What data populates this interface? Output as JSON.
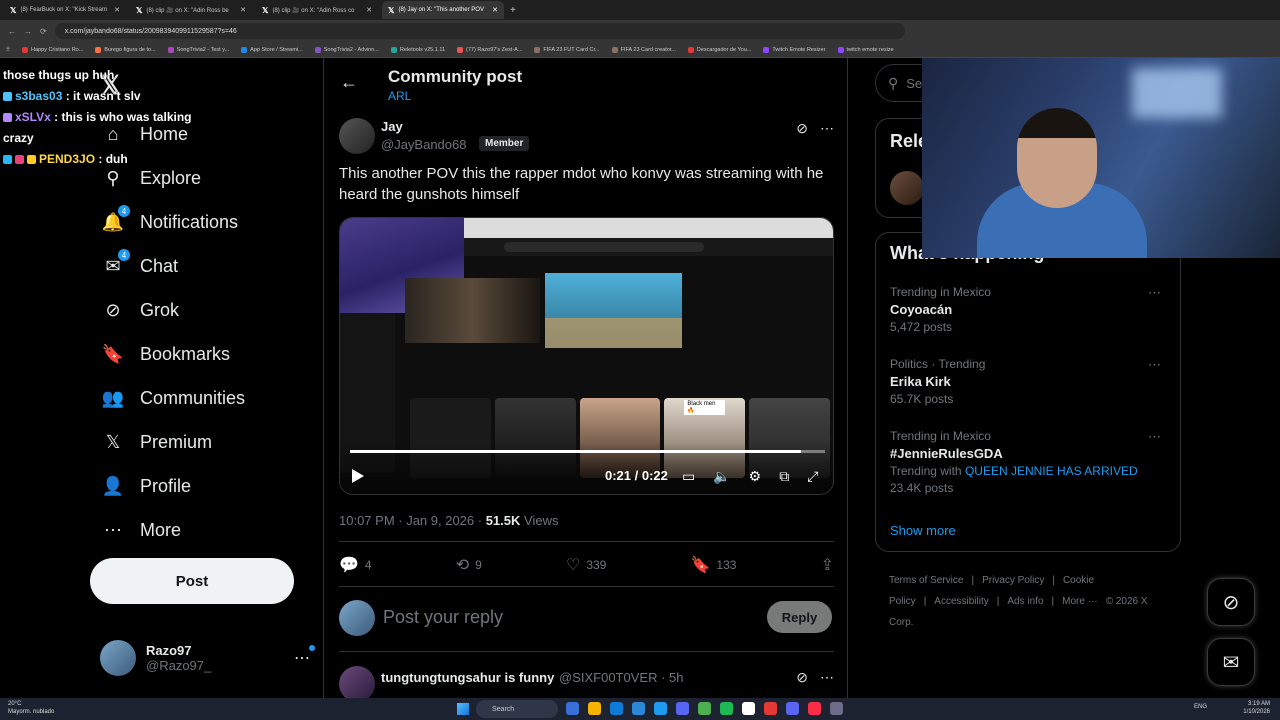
{
  "browser": {
    "tabs": [
      {
        "label": "(8) FearBuck on X: \"Kick Stream",
        "active": false
      },
      {
        "label": "(8) clip 🎥 on X: \"Adin Ross be",
        "active": false
      },
      {
        "label": "(8) clip 🎥 on X: \"Adin Ross co",
        "active": false
      },
      {
        "label": "(8) Jay on X: \"This another POV",
        "active": true
      }
    ],
    "url": "x.com/jaybando68/status/2009839409911529587?s=46",
    "bookmarks": [
      {
        "label": "Happy Cristiano Ro...",
        "color": "#e53935"
      },
      {
        "label": "Burego figura de to...",
        "color": "#ff7043"
      },
      {
        "label": "SongTrivia2 - Test y...",
        "color": "#ab47bc"
      },
      {
        "label": "App Store / Streami...",
        "color": "#1e88e5"
      },
      {
        "label": "SongTrivia2 - Advinn...",
        "color": "#7e57c2"
      },
      {
        "label": "Reletools v25.1.11",
        "color": "#26a69a"
      },
      {
        "label": "(77) Razo97's Zest-A...",
        "color": "#ef5350"
      },
      {
        "label": "FIFA 23 FUT Card Cr...",
        "color": "#8d6e63"
      },
      {
        "label": "FIFA 23 Card creator...",
        "color": "#8d6e63"
      },
      {
        "label": "Descargador de You...",
        "color": "#e53935"
      },
      {
        "label": "Twitch Emote Resizer",
        "color": "#9146ff"
      },
      {
        "label": "twitch emote resize",
        "color": "#9146ff"
      }
    ]
  },
  "chat": [
    {
      "user": "",
      "text": "those thugs up huh"
    },
    {
      "user": "s3bas03",
      "text": " : it wasn't slv"
    },
    {
      "user": "xSLVx",
      "text": " : this is who was talking crazy"
    },
    {
      "user": "PEND3JO",
      "text": " : duh"
    }
  ],
  "sidebar": {
    "items": [
      {
        "label": "Home",
        "icon": "home-icon",
        "glyph": "⌂",
        "badge": ""
      },
      {
        "label": "Explore",
        "icon": "search-icon",
        "glyph": "⚲",
        "badge": ""
      },
      {
        "label": "Notifications",
        "icon": "bell-icon",
        "glyph": "🔔",
        "badge": "4"
      },
      {
        "label": "Chat",
        "icon": "mail-icon",
        "glyph": "✉",
        "badge": "4"
      },
      {
        "label": "Grok",
        "icon": "grok-icon",
        "glyph": "⊘",
        "badge": ""
      },
      {
        "label": "Bookmarks",
        "icon": "bookmark-icon",
        "glyph": "🔖",
        "badge": ""
      },
      {
        "label": "Communities",
        "icon": "communities-icon",
        "glyph": "👥",
        "badge": ""
      },
      {
        "label": "Premium",
        "icon": "premium-icon",
        "glyph": "𝕏",
        "badge": ""
      },
      {
        "label": "Profile",
        "icon": "profile-icon",
        "glyph": "👤",
        "badge": ""
      },
      {
        "label": "More",
        "icon": "more-icon",
        "glyph": "⋯",
        "badge": ""
      }
    ],
    "post_label": "Post",
    "account": {
      "name": "Razo97",
      "handle": "@Razo97_"
    }
  },
  "header": {
    "title": "Community post",
    "subtitle": "ARL"
  },
  "post": {
    "author": "Jay",
    "handle": "@JayBando68",
    "member_badge": "Member",
    "text": "This another POV this the rapper mdot who konvy was streaming with he heard the gunshots himself",
    "video": {
      "time": "0:21 / 0:22",
      "progress": 0.95,
      "overlay_caption": "Black men 🔥"
    },
    "meta_time": "10:07 PM · Jan 9, 2026 · ",
    "views_count": "51.5K",
    "views_label": " Views",
    "stats": {
      "replies": "4",
      "reposts": "9",
      "likes": "339",
      "bookmarks": "133"
    },
    "reply_placeholder": "Post your reply",
    "reply_button": "Reply"
  },
  "reply": {
    "name": "tungtungtungsahur is funny",
    "handle": "@SIXF00T0VER · 5h"
  },
  "right": {
    "search_placeholder": "Sea",
    "relevant_title": "Rele",
    "happening_title": "What’s happening",
    "trends": [
      {
        "category": "Trending in Mexico",
        "name": "Coyoacán",
        "with_prefix": "",
        "with_link": "",
        "count": "5,472 posts"
      },
      {
        "category": "Politics · Trending",
        "name": "Erika Kirk",
        "with_prefix": "",
        "with_link": "",
        "count": "65.7K posts"
      },
      {
        "category": "Trending in Mexico",
        "name": "#JennieRulesGDA",
        "with_prefix": "Trending with ",
        "with_link": "QUEEN JENNIE HAS ARRIVED",
        "count": "23.4K posts"
      }
    ],
    "show_more": "Show more",
    "footer": [
      "Terms of Service",
      "|",
      "Privacy Policy",
      "|",
      "Cookie Policy",
      "|",
      "Accessibility",
      "|",
      "Ads info",
      "|",
      "More ···",
      "© 2026 X Corp."
    ]
  },
  "taskbar": {
    "weather_temp": "20°C",
    "weather_desc": "Mayorm. nublado",
    "search_label": "Search",
    "lang": "ENG",
    "time": "3:19 AM",
    "date": "1/10/2026"
  },
  "colors": {
    "accent": "#1d9bf0",
    "background": "#000000",
    "text": "#e7e9ea",
    "muted": "#71767b",
    "border": "#2f3336"
  }
}
